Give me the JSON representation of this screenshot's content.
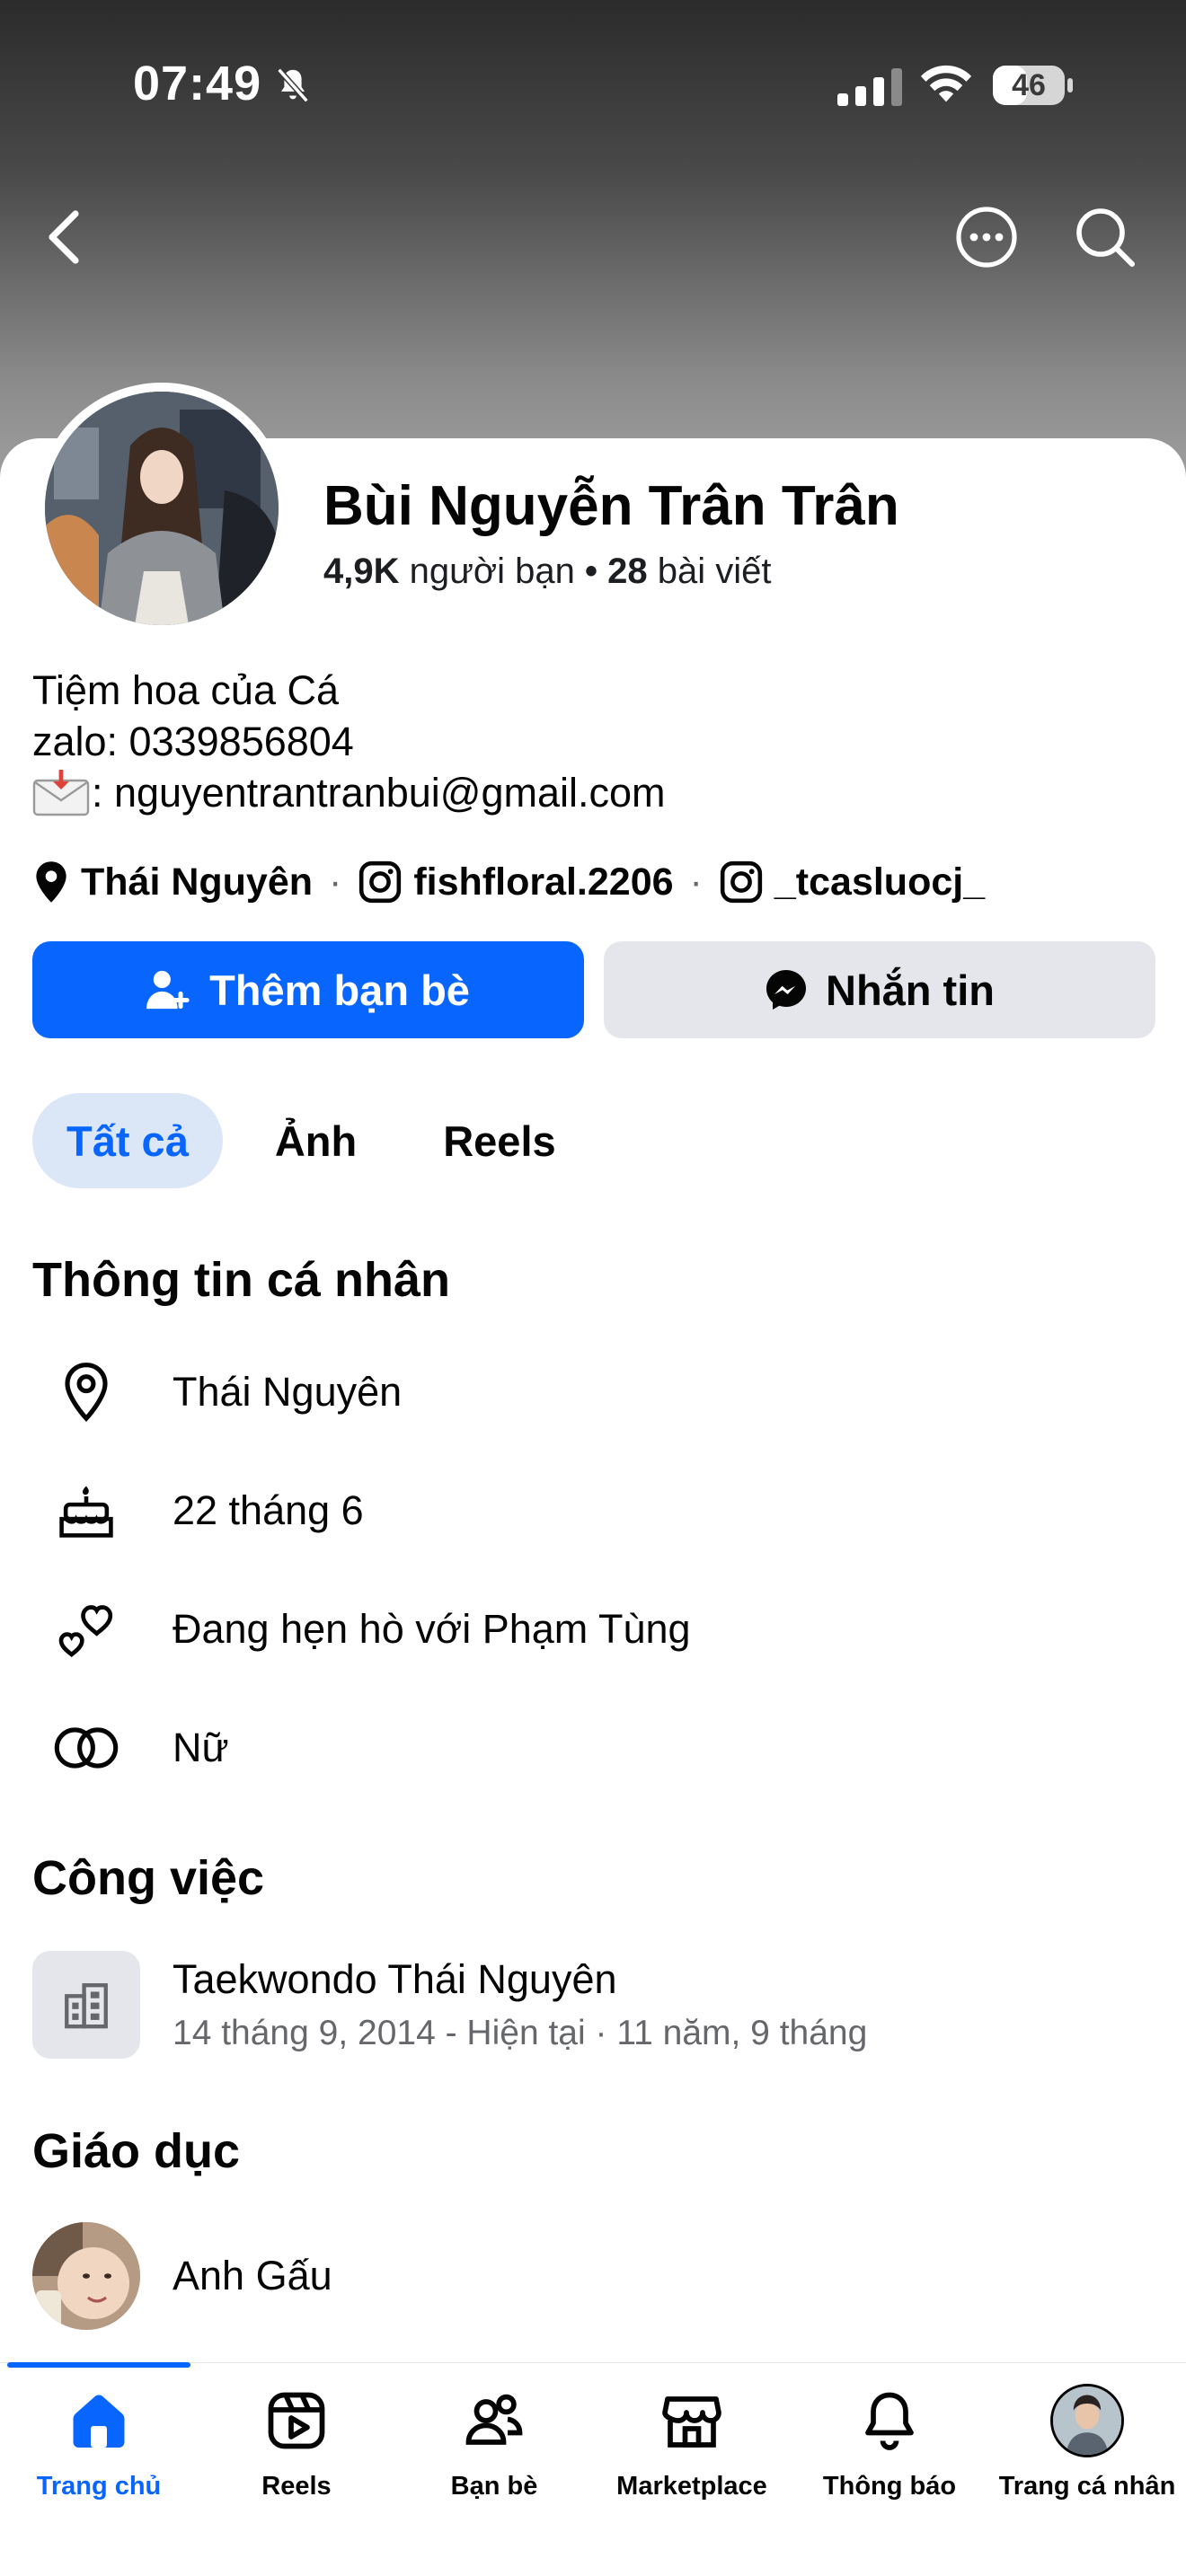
{
  "status_bar": {
    "time": "07:49",
    "battery": "46"
  },
  "profile": {
    "name": "Bùi Nguyễn Trân Trân",
    "friends_count": "4,9K",
    "friends_label": "người bạn",
    "separator": "•",
    "posts_count": "28",
    "posts_label": "bài viết"
  },
  "bio": {
    "line1": "Tiệm hoa của Cá",
    "line2": "zalo: 0339856804",
    "line3": ": nguyentrantranbui@gmail.com"
  },
  "links": {
    "location": "Thái Nguyên",
    "instagram1": "fishfloral.2206",
    "instagram2": "_tcasluocj_",
    "dot": "·"
  },
  "actions": {
    "add_friend": "Thêm bạn bè",
    "message": "Nhắn tin"
  },
  "tabs": [
    {
      "label": "Tất cả",
      "active": true
    },
    {
      "label": "Ảnh"
    },
    {
      "label": "Reels"
    }
  ],
  "personal_info": {
    "title": "Thông tin cá nhân",
    "items": [
      {
        "icon": "location-pin-icon",
        "text": "Thái Nguyên"
      },
      {
        "icon": "birthday-cake-icon",
        "text": "22 tháng 6"
      },
      {
        "icon": "relationship-hearts-icon",
        "text": "Đang hẹn hò với Phạm Tùng"
      },
      {
        "icon": "gender-rings-icon",
        "text": "Nữ"
      }
    ]
  },
  "work": {
    "title": "Công việc",
    "company": "Taekwondo Thái Nguyên",
    "period": "14 tháng 9, 2014 - Hiện tại · 11 năm, 9 tháng"
  },
  "education": {
    "title": "Giáo dục",
    "school": "Anh Gấu"
  },
  "bottom_nav": [
    {
      "label": "Trang chủ",
      "icon": "home-icon",
      "active": true
    },
    {
      "label": "Reels",
      "icon": "reels-icon"
    },
    {
      "label": "Bạn bè",
      "icon": "friends-icon"
    },
    {
      "label": "Marketplace",
      "icon": "marketplace-icon"
    },
    {
      "label": "Thông báo",
      "icon": "bell-icon"
    },
    {
      "label": "Trang cá nhân",
      "icon": "profile-avatar-icon"
    }
  ],
  "colors": {
    "accent": "#0866ff",
    "secondary_button": "#e4e6eb",
    "tab_active_bg": "#dbe7f7",
    "muted_text": "#65676b"
  }
}
